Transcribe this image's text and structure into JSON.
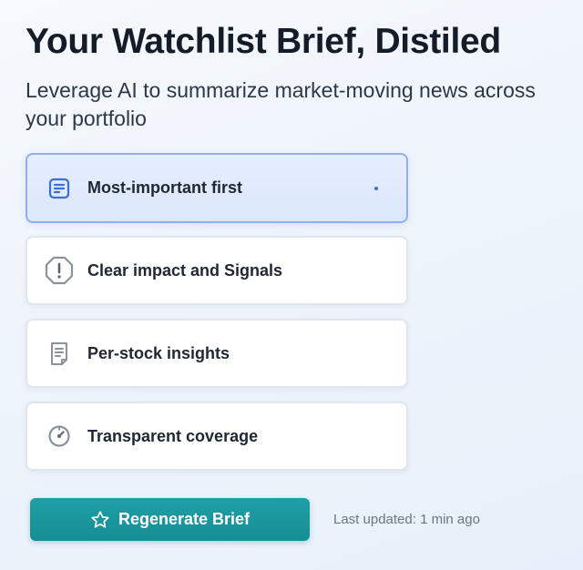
{
  "header": {
    "title": "Your Watchlist Brief, Distiled",
    "subtitle": "Leverage AI to summarize market-moving news across your portfolio"
  },
  "options": [
    {
      "label": "Most-important first",
      "icon": "document-lines-icon",
      "selected": true
    },
    {
      "label": "Clear impact and Signals",
      "icon": "alert-octagon-icon",
      "selected": false
    },
    {
      "label": "Per-stock insights",
      "icon": "document-list-icon",
      "selected": false
    },
    {
      "label": "Transparent coverage",
      "icon": "gauge-icon",
      "selected": false
    }
  ],
  "actions": {
    "regenerate_label": "Regenerate Brief",
    "regenerate_icon": "star-icon",
    "last_updated": "Last updated: 1 min ago"
  },
  "colors": {
    "accent": "#1a979d",
    "selected_border": "#8fb0f0",
    "selected_icon": "#3d6fd6"
  }
}
